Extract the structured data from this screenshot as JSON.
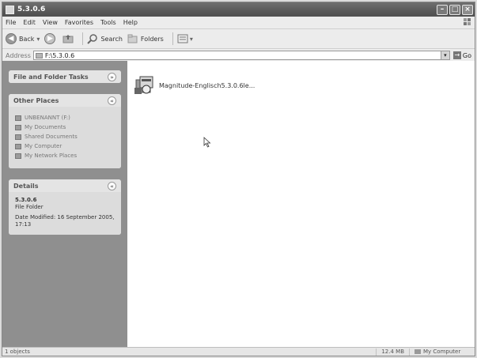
{
  "window": {
    "title": "5.3.0.6"
  },
  "menu": [
    "File",
    "Edit",
    "View",
    "Favorites",
    "Tools",
    "Help"
  ],
  "toolbar": {
    "back": "Back",
    "search": "Search",
    "folders": "Folders"
  },
  "address": {
    "label": "Address",
    "path": "F:\\5.3.0.6",
    "go": "Go"
  },
  "tasks": {
    "file_folder_tasks": "File and Folder Tasks",
    "other_places": {
      "title": "Other Places",
      "items": [
        "UNBENANNT (F:)",
        "My Documents",
        "Shared Documents",
        "My Computer",
        "My Network Places"
      ]
    },
    "details": {
      "title": "Details",
      "name": "5.3.0.6",
      "type": "File Folder",
      "modified": "Date Modified: 16 September 2005, 17:13"
    }
  },
  "files": [
    {
      "name": "Magnitude-Englisch5.3.0.6le..."
    }
  ],
  "status": {
    "left": "1 objects",
    "size": "12.4 MB",
    "location": "My Computer"
  }
}
